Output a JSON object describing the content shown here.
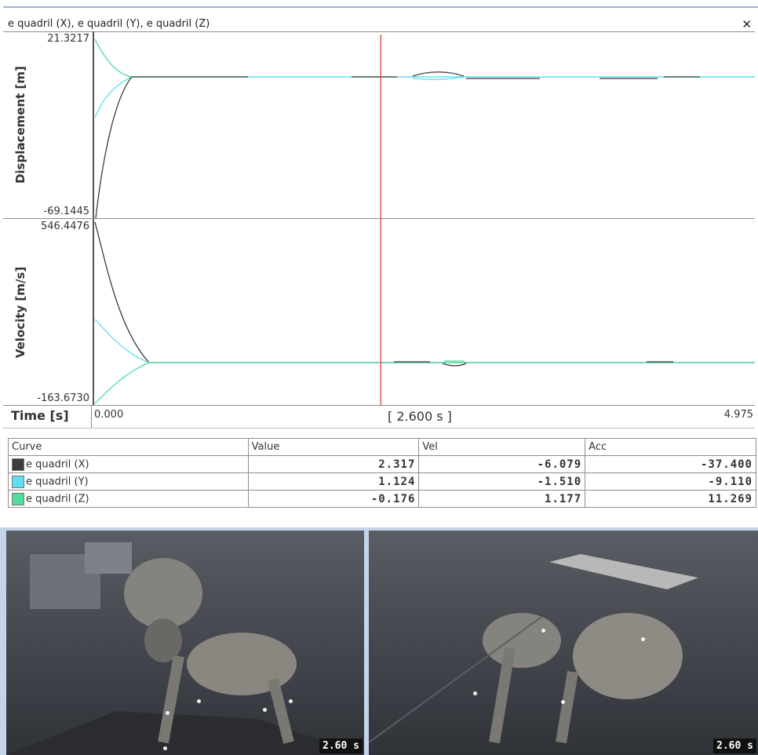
{
  "window": {
    "title": "e quadril (X), e quadril (Y), e quadril (Z)",
    "close_icon": "close-icon"
  },
  "displacement_panel": {
    "ylabel": "Displacement [m]",
    "ymax": "21.3217",
    "ymin": "-69.1445"
  },
  "velocity_panel": {
    "ylabel": "Velocity [m/s]",
    "ymax": "546.4476",
    "ymin": "-163.6730"
  },
  "time_axis": {
    "label": "Time [s]",
    "start": "0.000",
    "cursor": "[ 2.600 s ]",
    "end": "4.975",
    "cursor_time": 2.6,
    "duration": 4.975
  },
  "colors": {
    "x": "#3c3c3c",
    "y": "#5fe0f0",
    "z": "#4fdc9c",
    "cursor": "#e83a3a",
    "frame": "#9ab2d6"
  },
  "table": {
    "headers": [
      "Curve",
      "Value",
      "Vel",
      "Acc"
    ],
    "rows": [
      {
        "curve": "e quadril (X)",
        "value": "2.317",
        "vel": "-6.079",
        "acc": "-37.400"
      },
      {
        "curve": "e quadril (Y)",
        "value": "1.124",
        "vel": "-1.510",
        "acc": "-9.110"
      },
      {
        "curve": "e quadril (Z)",
        "value": "-0.176",
        "vel": "1.177",
        "acc": "11.269"
      }
    ]
  },
  "videos": {
    "left_time": "2.60 s",
    "right_time": "2.60 s"
  }
}
